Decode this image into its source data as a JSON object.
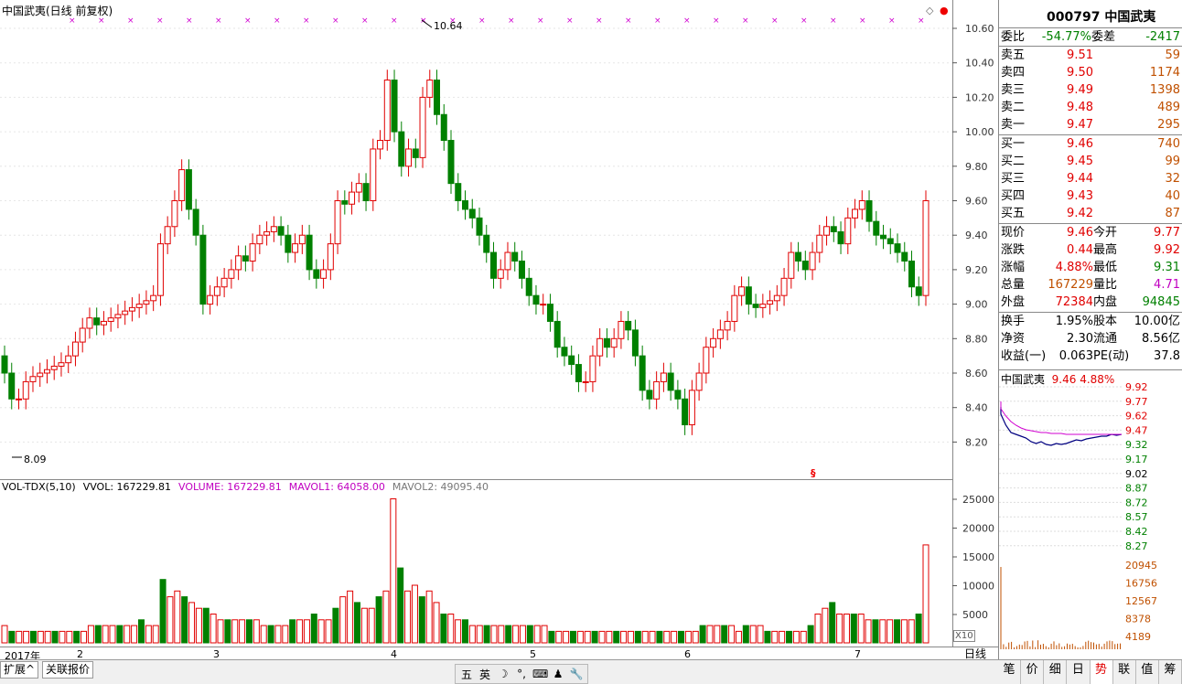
{
  "main": {
    "title": "中国武夷(日线 前复权)",
    "high_mark": "10.64",
    "low_mark": "8.09",
    "marker_symbol": "§",
    "y_ticks": [
      "10.60",
      "10.40",
      "10.20",
      "10.00",
      "9.80",
      "9.60",
      "9.40",
      "9.20",
      "9.00",
      "8.80",
      "8.60",
      "8.40",
      "8.20"
    ]
  },
  "volume": {
    "indicator": "VOL-TDX(5,10)",
    "vvol": "VVOL: 167229.81",
    "volume": "VOLUME: 167229.81",
    "mavol1": "MAVOL1: 64058.00",
    "mavol2": "MAVOL2: 49095.40",
    "y_ticks": [
      "25000",
      "20000",
      "15000",
      "10000",
      "5000"
    ],
    "unit": "X10"
  },
  "time_axis": {
    "labels": [
      "2017年",
      "2",
      "3",
      "4",
      "5",
      "6",
      "7"
    ],
    "period": "日线"
  },
  "bottom_tabs": [
    "扩展^",
    "关联报价"
  ],
  "ime": {
    "items": [
      "五",
      "英",
      "☽",
      "°,",
      "⌨",
      "♟",
      "🔧"
    ]
  },
  "quote": {
    "code": "000797",
    "name": "中国武夷",
    "weibi_label": "委比",
    "weibi": "-54.77%",
    "weicha_label": "委差",
    "weicha": "-2417",
    "sells": [
      {
        "label": "卖五",
        "price": "9.51",
        "vol": "59"
      },
      {
        "label": "卖四",
        "price": "9.50",
        "vol": "1174"
      },
      {
        "label": "卖三",
        "price": "9.49",
        "vol": "1398"
      },
      {
        "label": "卖二",
        "price": "9.48",
        "vol": "489"
      },
      {
        "label": "卖一",
        "price": "9.47",
        "vol": "295"
      }
    ],
    "buys": [
      {
        "label": "买一",
        "price": "9.46",
        "vol": "740"
      },
      {
        "label": "买二",
        "price": "9.45",
        "vol": "99"
      },
      {
        "label": "买三",
        "price": "9.44",
        "vol": "32"
      },
      {
        "label": "买四",
        "price": "9.43",
        "vol": "40"
      },
      {
        "label": "买五",
        "price": "9.42",
        "vol": "87"
      }
    ],
    "stats": [
      {
        "l": "现价",
        "v": "9.46",
        "l2": "今开",
        "v2": "9.77"
      },
      {
        "l": "涨跌",
        "v": "0.44",
        "l2": "最高",
        "v2": "9.92"
      },
      {
        "l": "涨幅",
        "v": "4.88%",
        "l2": "最低",
        "v2": "9.31"
      },
      {
        "l": "总量",
        "v": "167229",
        "l2": "量比",
        "v2": "4.71"
      },
      {
        "l": "外盘",
        "v": "72384",
        "l2": "内盘",
        "v2": "94845"
      }
    ],
    "fund": [
      {
        "l": "换手",
        "v": "1.95%",
        "l2": "股本",
        "v2": "10.00亿"
      },
      {
        "l": "净资",
        "v": "2.30",
        "l2": "流通",
        "v2": "8.56亿"
      },
      {
        "l": "收益(一)",
        "v": "0.063",
        "l2": "PE(动)",
        "v2": "37.8"
      }
    ]
  },
  "mini": {
    "name": "中国武夷",
    "price": "9.46",
    "pct": "4.88%",
    "price_ticks": [
      "9.92",
      "9.77",
      "9.62",
      "9.47",
      "9.32",
      "9.17",
      "9.02",
      "8.87",
      "8.72",
      "8.57",
      "8.42",
      "8.27"
    ],
    "vol_ticks": [
      "20945",
      "16756",
      "12567",
      "8378",
      "4189"
    ]
  },
  "right_tabs": [
    "笔",
    "价",
    "细",
    "日",
    "势",
    "联",
    "值",
    "筹"
  ],
  "colors": {
    "up": "#e00000",
    "down": "#008000",
    "ma1": "#d000d0",
    "ma2": "#808080"
  }
}
